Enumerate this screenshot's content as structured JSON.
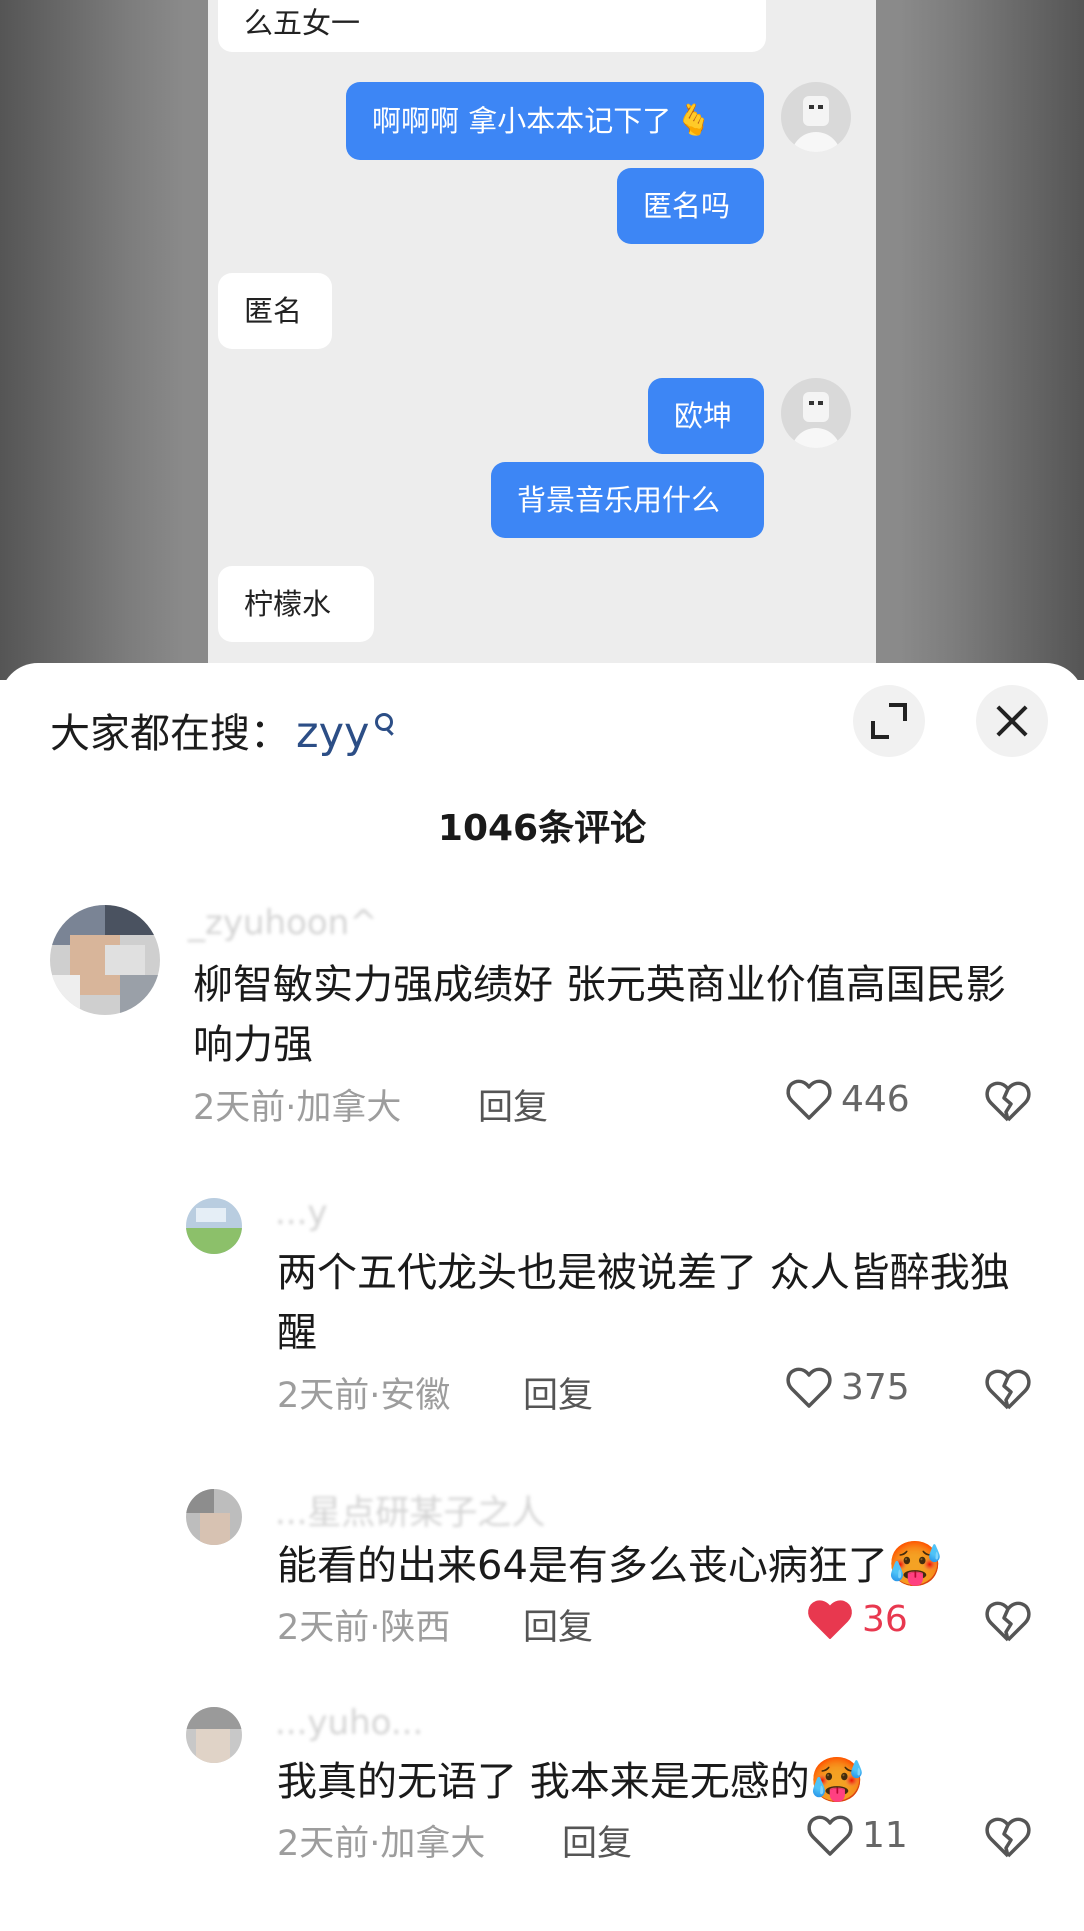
{
  "chat": {
    "messages": [
      {
        "side": "in",
        "text": "么五女一"
      },
      {
        "side": "out",
        "text": "啊啊啊 拿小本本记下了",
        "emoji": "🫰"
      },
      {
        "side": "out",
        "text": "匿名吗"
      },
      {
        "side": "in",
        "text": "匿名"
      },
      {
        "side": "out",
        "text": "欧坤"
      },
      {
        "side": "out",
        "text": "背景音乐用什么"
      },
      {
        "side": "in",
        "text": "柠檬水"
      }
    ]
  },
  "sheet": {
    "search_prefix": "大家都在搜：",
    "search_term": "zyy",
    "comment_count": "1046条评论",
    "colors": {
      "accent": "#2c4e86",
      "liked": "#e8384f",
      "chat_out": "#3d86f5"
    }
  },
  "comments": [
    {
      "username": "_zyuhoon^",
      "text": "柳智敏实力强成绩好 张元英商业价值高国民影响力强",
      "meta": "2天前·加拿大",
      "reply": "回复",
      "likes": "446",
      "liked": false
    },
    {
      "username": "...y",
      "text": "两个五代龙头也是被说差了 众人皆醉我独醒",
      "meta": "2天前·安徽",
      "reply": "回复",
      "likes": "375",
      "liked": false
    },
    {
      "username": "...星点研某子之人",
      "text": "能看的出来64是有多么丧心病狂了",
      "emoji": "🥵",
      "meta": "2天前·陕西",
      "reply": "回复",
      "likes": "36",
      "liked": true
    },
    {
      "username": "...yuho...",
      "text": "我真的无语了 我本来是无感的",
      "emoji": "🥵",
      "meta": "2天前·加拿大",
      "reply": "回复",
      "likes": "11",
      "liked": false
    }
  ]
}
